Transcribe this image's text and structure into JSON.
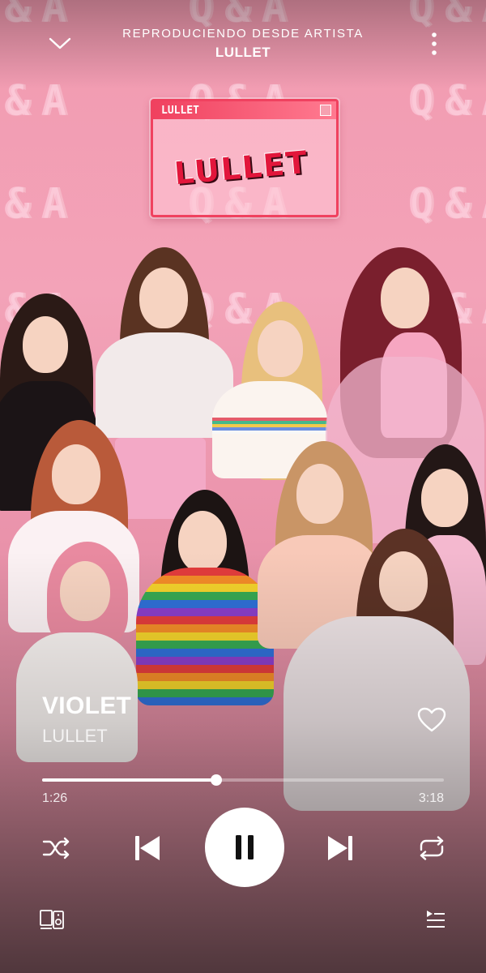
{
  "header": {
    "context_label": "REPRODUCIENDO DESDE ARTISTA",
    "context_name": "LULLET",
    "collapse_icon": "chevron-down-icon",
    "more_icon": "more-vertical-icon"
  },
  "artwork": {
    "window_title": "LULLET",
    "logo_text": "LULLET",
    "pattern_text": "Q&A"
  },
  "track": {
    "title": "VIOLET",
    "artist": "LULLET",
    "liked": false
  },
  "playback": {
    "elapsed": "1:26",
    "duration": "3:18",
    "progress_fraction": 0.4343,
    "state": "playing"
  },
  "controls": {
    "shuffle_icon": "shuffle-icon",
    "previous_icon": "skip-previous-icon",
    "play_pause_icon": "pause-icon",
    "next_icon": "skip-next-icon",
    "repeat_icon": "repeat-icon",
    "devices_icon": "devices-icon",
    "queue_icon": "queue-icon"
  },
  "colors": {
    "background_tint": "#e98aa4",
    "logo_red": "#e2163b",
    "control_white": "#ffffff"
  }
}
